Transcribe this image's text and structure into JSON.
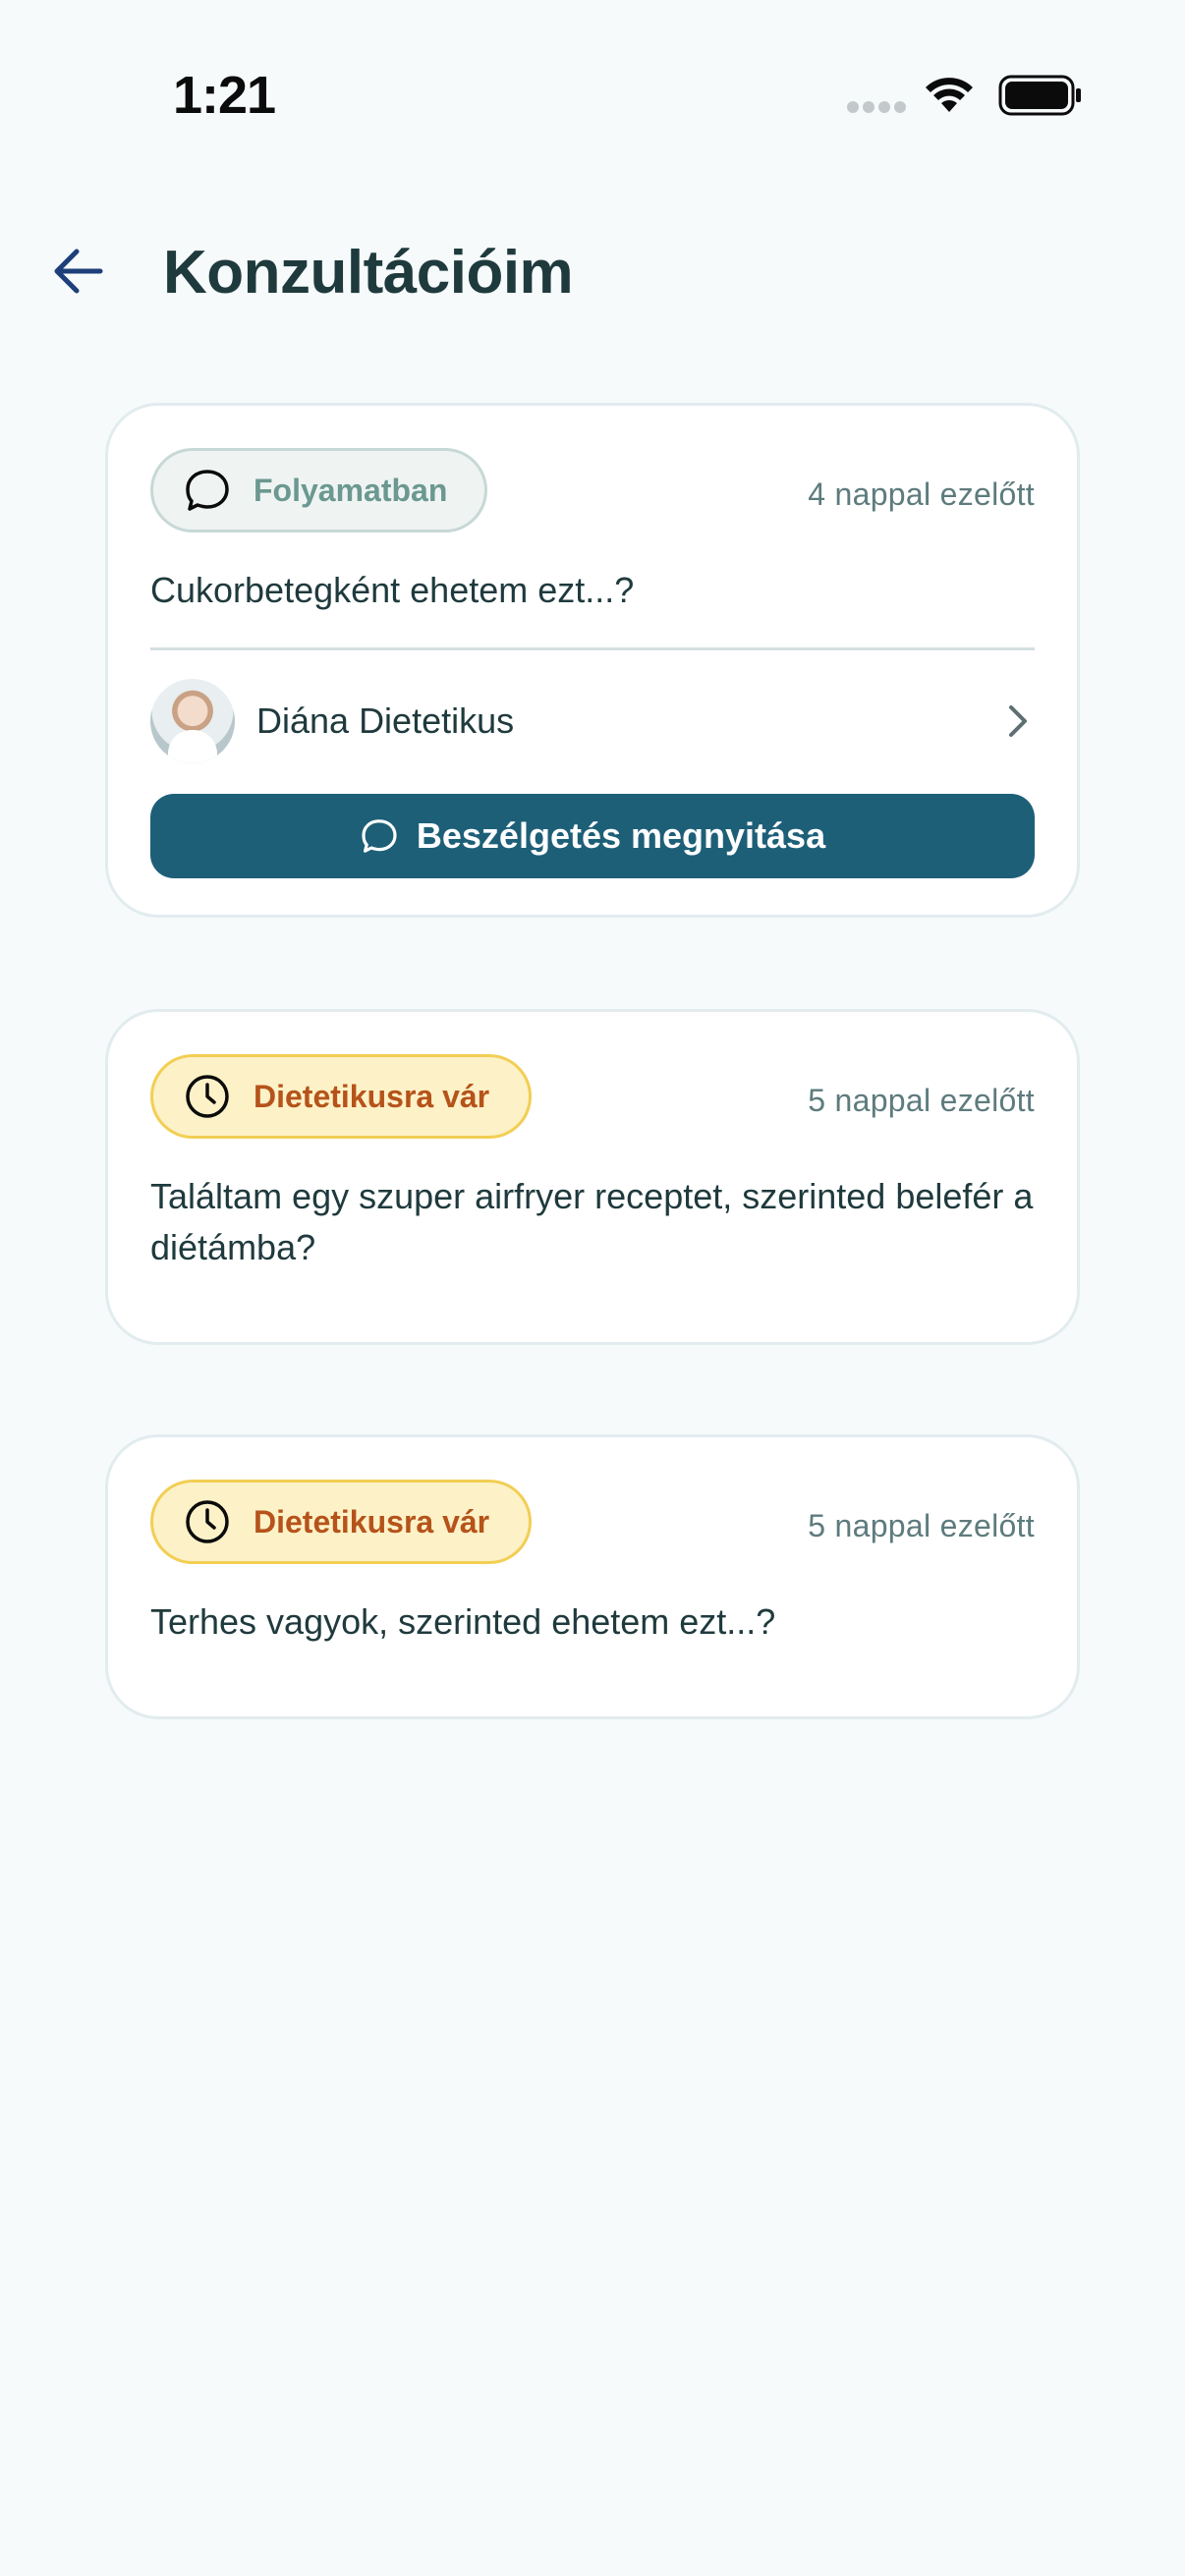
{
  "status_bar": {
    "time": "1:21"
  },
  "header": {
    "title": "Konzultációim",
    "back_icon": "arrow-left-icon"
  },
  "colors": {
    "background": "#f6fafb",
    "primary_button": "#1e5f78",
    "title_text": "#1f3a3d",
    "badge_progress_bg": "#eff4f3",
    "badge_progress_text": "#6b9890",
    "badge_waiting_bg": "#fdf1c7",
    "badge_waiting_text": "#b5531a"
  },
  "consultations": [
    {
      "status": "Folyamatban",
      "status_icon": "chat-bubble-icon",
      "time_ago": "4 nappal ezelőtt",
      "question": "Cukorbetegként ehetem ezt...?",
      "expert_name": "Diána Dietetikus",
      "open_button_label": "Beszélgetés megnyitása"
    },
    {
      "status": "Dietetikusra vár",
      "status_icon": "clock-icon",
      "time_ago": "5 nappal ezelőtt",
      "question": "Találtam egy szuper airfryer receptet, szerinted belefér a diétámba?"
    },
    {
      "status": "Dietetikusra vár",
      "status_icon": "clock-icon",
      "time_ago": "5 nappal ezelőtt",
      "question": "Terhes vagyok, szerinted ehetem ezt...?"
    }
  ]
}
